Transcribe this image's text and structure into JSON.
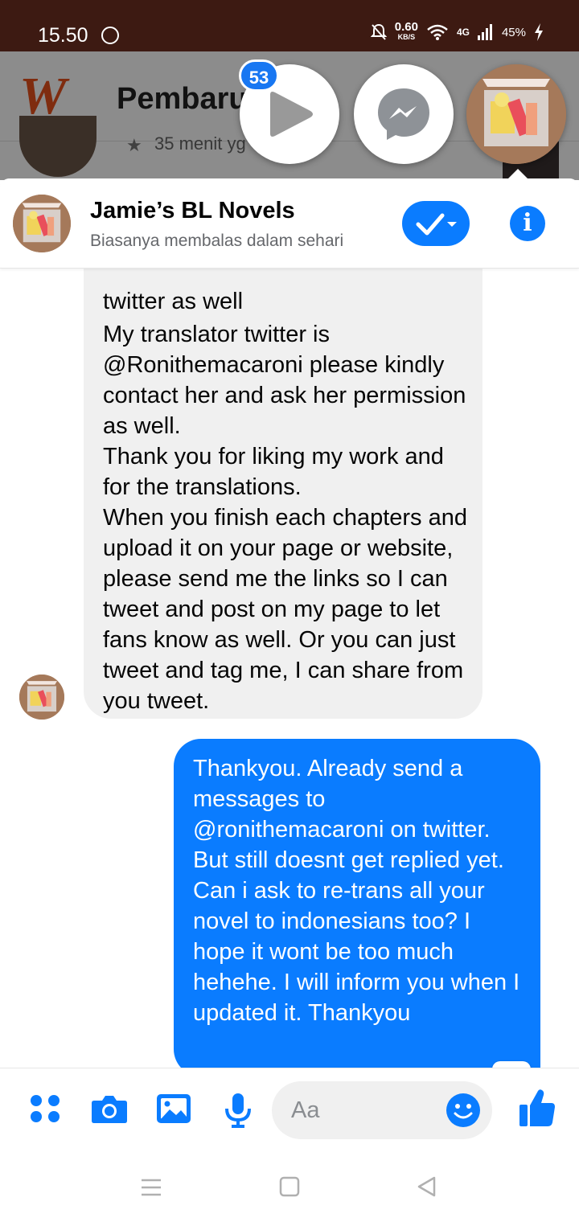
{
  "status_bar": {
    "time": "15.50",
    "speed_value": "0.60",
    "speed_unit": "KB/S",
    "network": "4G",
    "battery": "45%"
  },
  "background_app": {
    "title": "Pembaru",
    "row_time": "35 menit yg"
  },
  "chat_heads": {
    "badge_count": "53"
  },
  "chat": {
    "contact_name": "Jamie’s BL Novels",
    "subtitle": "Biasanya membalas dalam sehari",
    "incoming_cut_line": "twitter as well",
    "incoming_message": "My translator twitter is @Ronithemacaroni please kindly contact her and ask her permission as well.\nThank you for liking my work and for the translations.\nWhen you finish each chapters and upload it on your page or website, please send me the links so I can tweet and post on my page to let fans know as well. Or you can just tweet and tag me, I can share from you tweet.",
    "outgoing_message": "Thankyou. Already send a messages to @ronithemacaroni on twitter. But still doesnt get replied yet. Can i ask to re-trans all your novel to indonesians too? I hope it wont be too much hehehe. I will inform you when I updated it. Thankyou"
  },
  "composer": {
    "placeholder": "Aa"
  },
  "colors": {
    "accent": "#0a7cff",
    "status_bar": "#3d1a12",
    "wattpad": "#e8501c"
  }
}
